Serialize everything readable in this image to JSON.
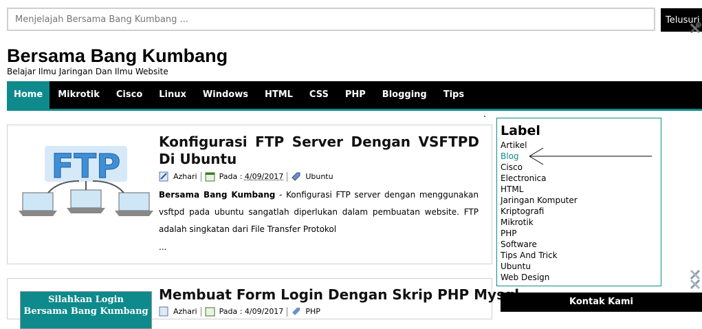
{
  "search": {
    "placeholder": "Menjelajah Bersama Bang Kumbang ...",
    "button_label": "Telusuri"
  },
  "header": {
    "title": "Bersama Bang Kumbang",
    "description": "Belajar Ilmu Jaringan Dan Ilmu Website"
  },
  "nav": {
    "items": [
      "Home",
      "Mikrotik",
      "Cisco",
      "Linux",
      "Windows",
      "HTML",
      "CSS",
      "PHP",
      "Blogging",
      "Tips"
    ],
    "active": "Home"
  },
  "posts": [
    {
      "title": "Konfigurasi FTP Server Dengan VSFTPD Di Ubuntu",
      "author": "Azhari",
      "date_label": "Pada :",
      "date": "4/09/2017",
      "category": "Ubuntu",
      "excerpt_lead": "Bersama Bang Kumbang",
      "excerpt": " - Konfigurasi FTP server dengan menggunakan vsftpd pada ubuntu sangatlah diperlukan dalam pembuatan website. FTP adalah singkatan dari File Transfer Protokol",
      "more": "...",
      "thumb_text": "FTP"
    },
    {
      "title": "Membuat Form Login Dengan Skrip PHP Mysql",
      "author": "Azhari",
      "date_label": "Pada :",
      "date": "4/09/2017",
      "category": "PHP",
      "thumb_line1": "Silahkan Login",
      "thumb_line2": "Bersama Bang Kumbang"
    }
  ],
  "sidebar": {
    "label_title": "Label",
    "labels": [
      "Artikel",
      "Blog",
      "Cisco",
      "Electronica",
      "HTML",
      "Jaringan Komputer",
      "Kriptografi",
      "Mikrotik",
      "PHP",
      "Software",
      "Tips And Trick",
      "Ubuntu",
      "Web Design"
    ],
    "highlighted": "Blog",
    "contact_title": "Kontak Kami"
  },
  "colors": {
    "accent": "#0e8a8c",
    "nav_bg": "#000000",
    "border": "#cfcfcf"
  },
  "icons": [
    "tools-icon",
    "author-icon",
    "calendar-icon",
    "tag-icon",
    "arrow-annotation"
  ]
}
